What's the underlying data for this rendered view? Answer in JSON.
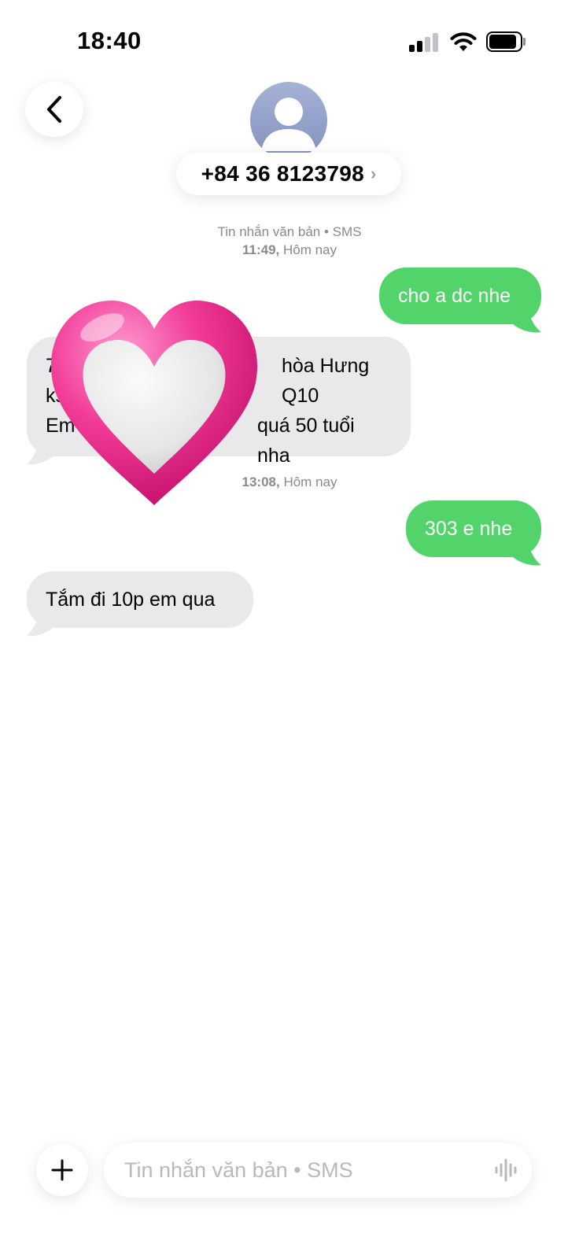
{
  "status_bar": {
    "time": "18:40"
  },
  "header": {
    "contact": "+84 36 8123798",
    "chevron": "›"
  },
  "meta": [
    {
      "line1": "Tin nhắn văn bản • SMS",
      "time": "11:49,",
      "day": "Hôm nay"
    },
    {
      "time": "13:08,",
      "day": "Hôm nay"
    }
  ],
  "messages": [
    {
      "direction": "outgoing",
      "text": "cho a dc nhe"
    },
    {
      "direction": "incoming",
      "lines": [
        "7",
        "hòa Hưng Q10",
        "ks",
        "Em t",
        "quá 50 tuổi nha"
      ]
    },
    {
      "direction": "outgoing",
      "text": "303 e nhe"
    },
    {
      "direction": "incoming",
      "text": "Tắm đi 10p em qua"
    }
  ],
  "overlay": {
    "icon": "heart-sticker-icon"
  },
  "compose": {
    "placeholder": "Tin nhắn văn bản • SMS",
    "value": ""
  },
  "colors": {
    "outgoing_bubble": "#52d46b",
    "incoming_bubble": "#e9e9eb",
    "heart_pink": "#f0318f",
    "avatar": "#8f9cc9"
  },
  "icons": [
    "back-chevron-icon",
    "person-avatar-icon",
    "cellular-signal-icon",
    "wifi-icon",
    "battery-icon",
    "plus-icon",
    "audio-waveform-icon"
  ]
}
